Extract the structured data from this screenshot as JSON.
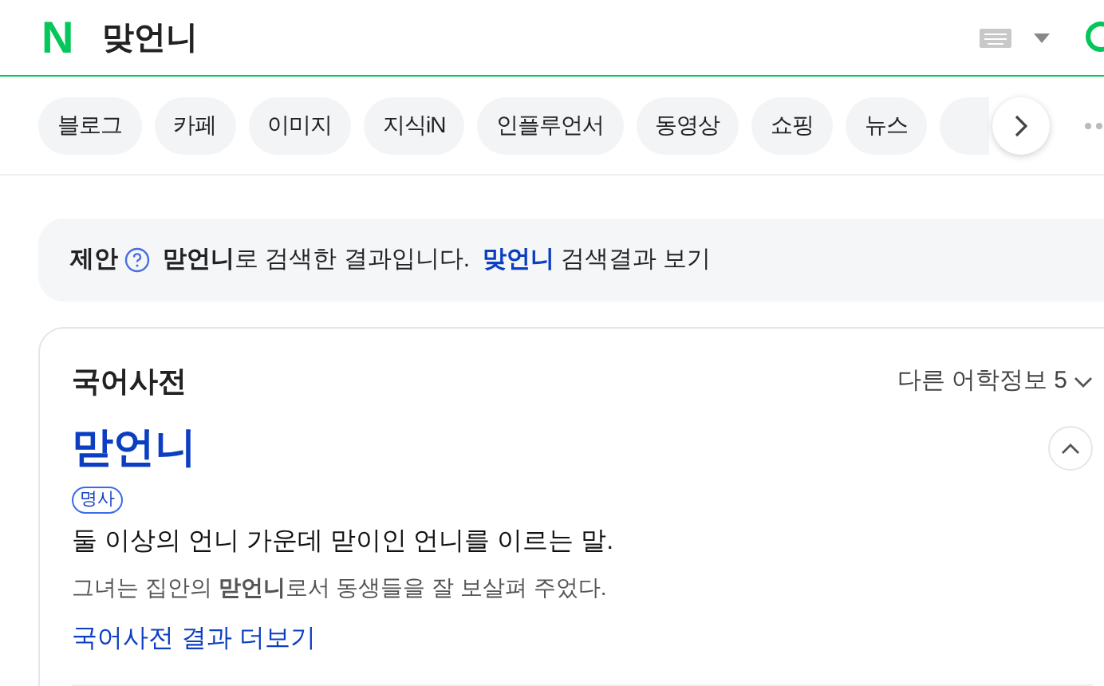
{
  "header": {
    "logo": "N",
    "query": "맞언니"
  },
  "tabs": [
    {
      "label": "블로그",
      "selected": false
    },
    {
      "label": "카페",
      "selected": false
    },
    {
      "label": "이미지",
      "selected": false
    },
    {
      "label": "지식iN",
      "selected": false
    },
    {
      "label": "인플루언서",
      "selected": false
    },
    {
      "label": "동영상",
      "selected": false
    },
    {
      "label": "쇼핑",
      "selected": false
    },
    {
      "label": "뉴스",
      "selected": false
    }
  ],
  "suggestion": {
    "label": "제안",
    "message": "**맏언니**로 검색한 결과입니다.",
    "link": "맞언니",
    "link_suffix": "검색결과 보기"
  },
  "dictionary": {
    "title": "국어사전",
    "more_info": "다른 어학정보 5",
    "expanded": true,
    "word": "맏언니",
    "part_of_speech": "명사",
    "definition": "둘 이상의 언니 가운데 맏이인 언니를 이르는 말.",
    "example": "그녀는 집안의 **맏언니**로서 동생들을 잘 보살펴 주었다.",
    "more_link": "국어사전 결과 더보기"
  }
}
